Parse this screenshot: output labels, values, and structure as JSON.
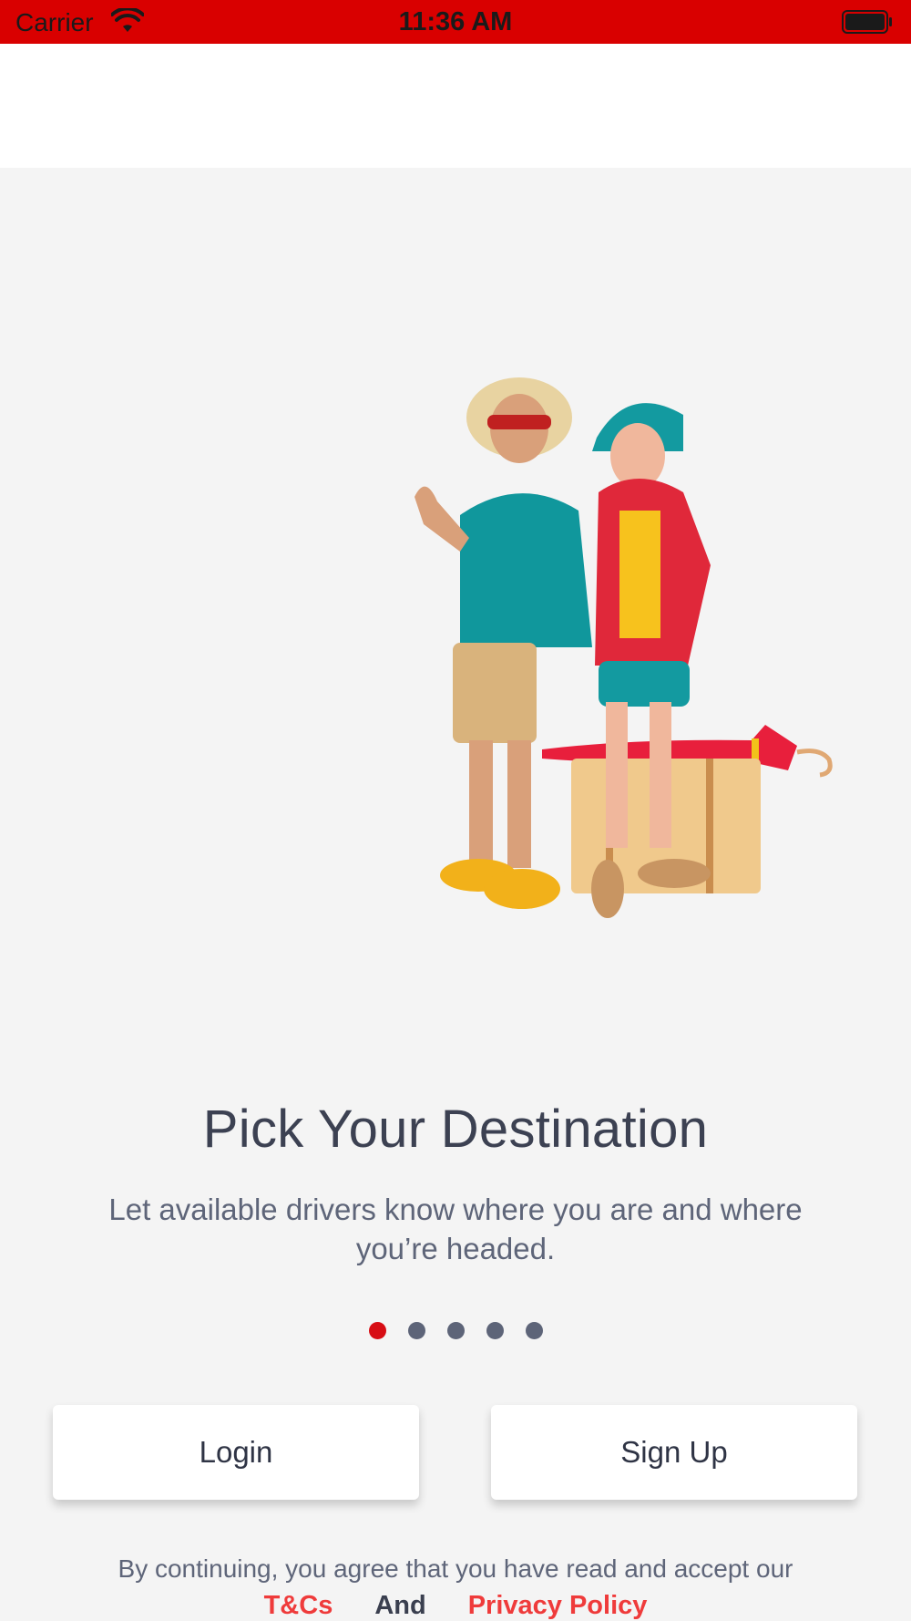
{
  "status_bar": {
    "carrier": "Carrier",
    "time": "11:36 AM",
    "color": "#d90000"
  },
  "onboarding": {
    "title": "Pick Your Destination",
    "subtitle": "Let available drivers know where you are and where you’re headed.",
    "page_count": 5,
    "active_page": 1
  },
  "actions": {
    "login_label": "Login",
    "signup_label": "Sign Up"
  },
  "legal": {
    "prefix": "By continuing, you agree that you have read and accept our",
    "terms_label": "T&Cs",
    "and_label": "And",
    "privacy_label": "Privacy Policy",
    "link_color": "#ef3b3b"
  }
}
